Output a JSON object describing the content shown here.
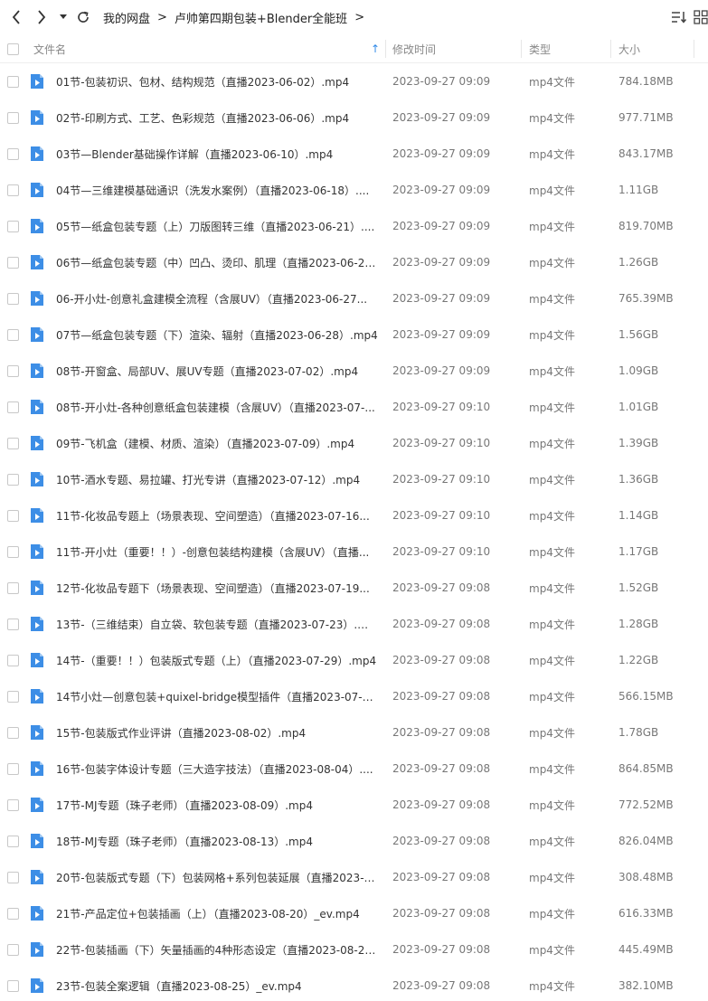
{
  "breadcrumb": [
    "我的网盘",
    "卢帅第四期包装+Blender全能班"
  ],
  "columns": {
    "name": "文件名",
    "time": "修改时间",
    "type": "类型",
    "size": "大小"
  },
  "files": [
    {
      "name": "01节-包装初识、包材、结构规范（直播2023-06-02）.mp4",
      "time": "2023-09-27 09:09",
      "type": "mp4文件",
      "size": "784.18MB"
    },
    {
      "name": "02节-印刷方式、工艺、色彩规范（直播2023-06-06）.mp4",
      "time": "2023-09-27 09:09",
      "type": "mp4文件",
      "size": "977.71MB"
    },
    {
      "name": "03节—Blender基础操作详解（直播2023-06-10）.mp4",
      "time": "2023-09-27 09:09",
      "type": "mp4文件",
      "size": "843.17MB"
    },
    {
      "name": "04节—三维建模基础通识（洗发水案例）（直播2023-06-18）....",
      "time": "2023-09-27 09:09",
      "type": "mp4文件",
      "size": "1.11GB"
    },
    {
      "name": "05节—纸盒包装专题（上）刀版图转三维（直播2023-06-21）....",
      "time": "2023-09-27 09:09",
      "type": "mp4文件",
      "size": "819.70MB"
    },
    {
      "name": "06节—纸盒包装专题（中）凹凸、烫印、肌理（直播2023-06-25...",
      "time": "2023-09-27 09:09",
      "type": "mp4文件",
      "size": "1.26GB"
    },
    {
      "name": "06-开小灶-创意礼盒建模全流程（含展UV）（直播2023-06-27...",
      "time": "2023-09-27 09:09",
      "type": "mp4文件",
      "size": "765.39MB"
    },
    {
      "name": "07节—纸盒包装专题（下）渲染、辐射（直播2023-06-28）.mp4",
      "time": "2023-09-27 09:09",
      "type": "mp4文件",
      "size": "1.56GB"
    },
    {
      "name": "08节-开窗盒、局部UV、展UV专题（直播2023-07-02）.mp4",
      "time": "2023-09-27 09:09",
      "type": "mp4文件",
      "size": "1.09GB"
    },
    {
      "name": "08节-开小灶-各种创意纸盒包装建模（含展UV）（直播2023-07-...",
      "time": "2023-09-27 09:10",
      "type": "mp4文件",
      "size": "1.01GB"
    },
    {
      "name": "09节-飞机盒（建模、材质、渲染）（直播2023-07-09）.mp4",
      "time": "2023-09-27 09:10",
      "type": "mp4文件",
      "size": "1.39GB"
    },
    {
      "name": "10节-酒水专题、易拉罐、打光专讲（直播2023-07-12）.mp4",
      "time": "2023-09-27 09:10",
      "type": "mp4文件",
      "size": "1.36GB"
    },
    {
      "name": "11节-化妆品专题上（场景表现、空间塑造）（直播2023-07-16...",
      "time": "2023-09-27 09:10",
      "type": "mp4文件",
      "size": "1.14GB"
    },
    {
      "name": "11节-开小灶（重要！！）-创意包装结构建模（含展UV）（直播...",
      "time": "2023-09-27 09:10",
      "type": "mp4文件",
      "size": "1.17GB"
    },
    {
      "name": "12节-化妆品专题下（场景表现、空间塑造）（直播2023-07-19...",
      "time": "2023-09-27 09:08",
      "type": "mp4文件",
      "size": "1.52GB"
    },
    {
      "name": "13节-（三维结束）自立袋、软包装专题（直播2023-07-23）.mp4",
      "time": "2023-09-27 09:08",
      "type": "mp4文件",
      "size": "1.28GB"
    },
    {
      "name": "14节-（重要！！）包装版式专题（上）（直播2023-07-29）.mp4",
      "time": "2023-09-27 09:08",
      "type": "mp4文件",
      "size": "1.22GB"
    },
    {
      "name": "14节小灶—创意包装+quixel-bridge模型插件（直播2023-07-3...",
      "time": "2023-09-27 09:08",
      "type": "mp4文件",
      "size": "566.15MB"
    },
    {
      "name": "15节-包装版式作业评讲（直播2023-08-02）.mp4",
      "time": "2023-09-27 09:08",
      "type": "mp4文件",
      "size": "1.78GB"
    },
    {
      "name": "16节-包装字体设计专题（三大造字技法）（直播2023-08-04）....",
      "time": "2023-09-27 09:08",
      "type": "mp4文件",
      "size": "864.85MB"
    },
    {
      "name": "17节-MJ专题（珠子老师）（直播2023-08-09）.mp4",
      "time": "2023-09-27 09:08",
      "type": "mp4文件",
      "size": "772.52MB"
    },
    {
      "name": "18节-MJ专题（珠子老师）（直播2023-08-13）.mp4",
      "time": "2023-09-27 09:08",
      "type": "mp4文件",
      "size": "826.04MB"
    },
    {
      "name": "20节-包装版式专题（下）包装网格+系列包装延展（直播2023-0...",
      "time": "2023-09-27 09:08",
      "type": "mp4文件",
      "size": "308.48MB"
    },
    {
      "name": "21节-产品定位+包装插画（上）（直播2023-08-20）_ev.mp4",
      "time": "2023-09-27 09:08",
      "type": "mp4文件",
      "size": "616.33MB"
    },
    {
      "name": "22节-包装插画（下）矢量插画的4种形态设定（直播2023-08-23...",
      "time": "2023-09-27 09:08",
      "type": "mp4文件",
      "size": "445.49MB"
    },
    {
      "name": "23节-包装全案逻辑（直播2023-08-25）_ev.mp4",
      "time": "2023-09-27 09:08",
      "type": "mp4文件",
      "size": "382.10MB"
    }
  ],
  "colors": {
    "accent": "#2f89e8",
    "file_icon": "#3d8ee6"
  }
}
